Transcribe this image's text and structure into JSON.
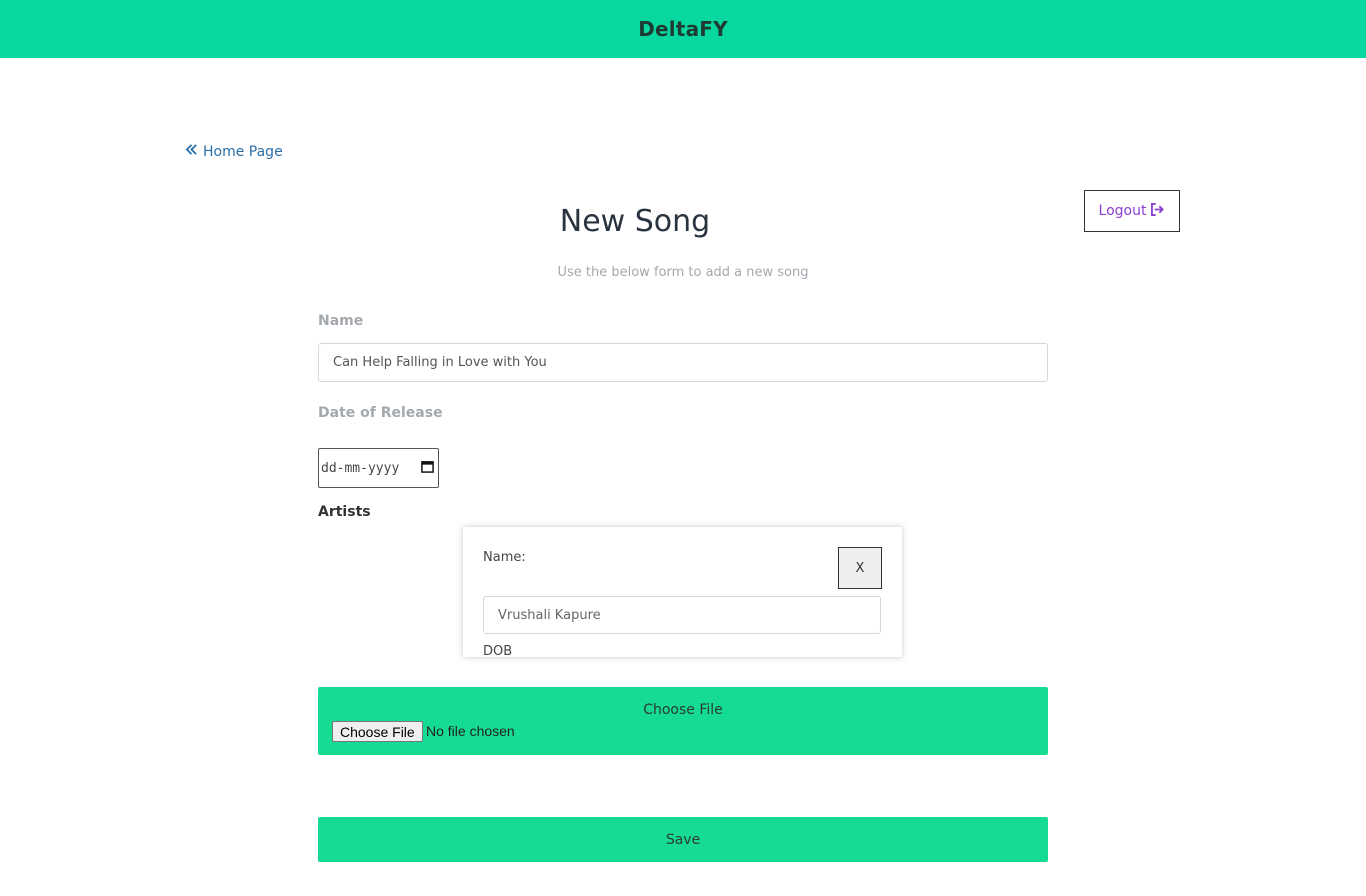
{
  "header": {
    "brand": "DeltaFY"
  },
  "nav": {
    "home_label": "Home Page",
    "logout_label": "Logout"
  },
  "page": {
    "title": "New Song",
    "subtitle": "Use the below form to add a new song"
  },
  "form": {
    "name_label": "Name",
    "name_value": "Can Help Falling in Love with You",
    "date_label": "Date of Release",
    "date_placeholder": "dd-mm-yyyy",
    "artists_label": "Artists",
    "artist": {
      "name_label": "Name:",
      "name_value": "Vrushali Kapure",
      "close_label": "X",
      "dob_label": "DOB"
    },
    "file": {
      "title": "Choose File",
      "button_label": "Choose File",
      "status": "No file chosen"
    },
    "save_label": "Save"
  },
  "colors": {
    "header": "#08d8a0",
    "button": "#16db93",
    "link": "#2a6fa8",
    "logout": "#8a3fd0"
  }
}
